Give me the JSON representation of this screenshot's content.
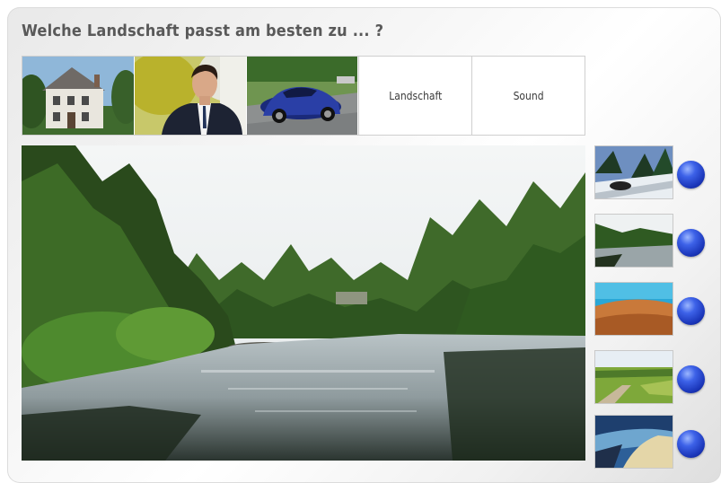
{
  "header": {
    "title": "Welche Landschaft passt am besten zu ... ?"
  },
  "thumbnails": [
    {
      "icon": "villa-photo"
    },
    {
      "icon": "businessman-photo"
    },
    {
      "icon": "sports-car-photo"
    }
  ],
  "tabs": [
    {
      "label": "Landschaft"
    },
    {
      "label": "Sound"
    }
  ],
  "main_image": {
    "icon": "river-forest-landscape-photo"
  },
  "options": [
    {
      "icon": "snowy-road-car-photo"
    },
    {
      "icon": "river-lake-photo"
    },
    {
      "icon": "desert-dunes-photo"
    },
    {
      "icon": "country-road-fields-photo"
    },
    {
      "icon": "beach-coast-photo"
    }
  ],
  "colors": {
    "radio_blue": "#2a48d0",
    "title_gray": "#595959"
  }
}
